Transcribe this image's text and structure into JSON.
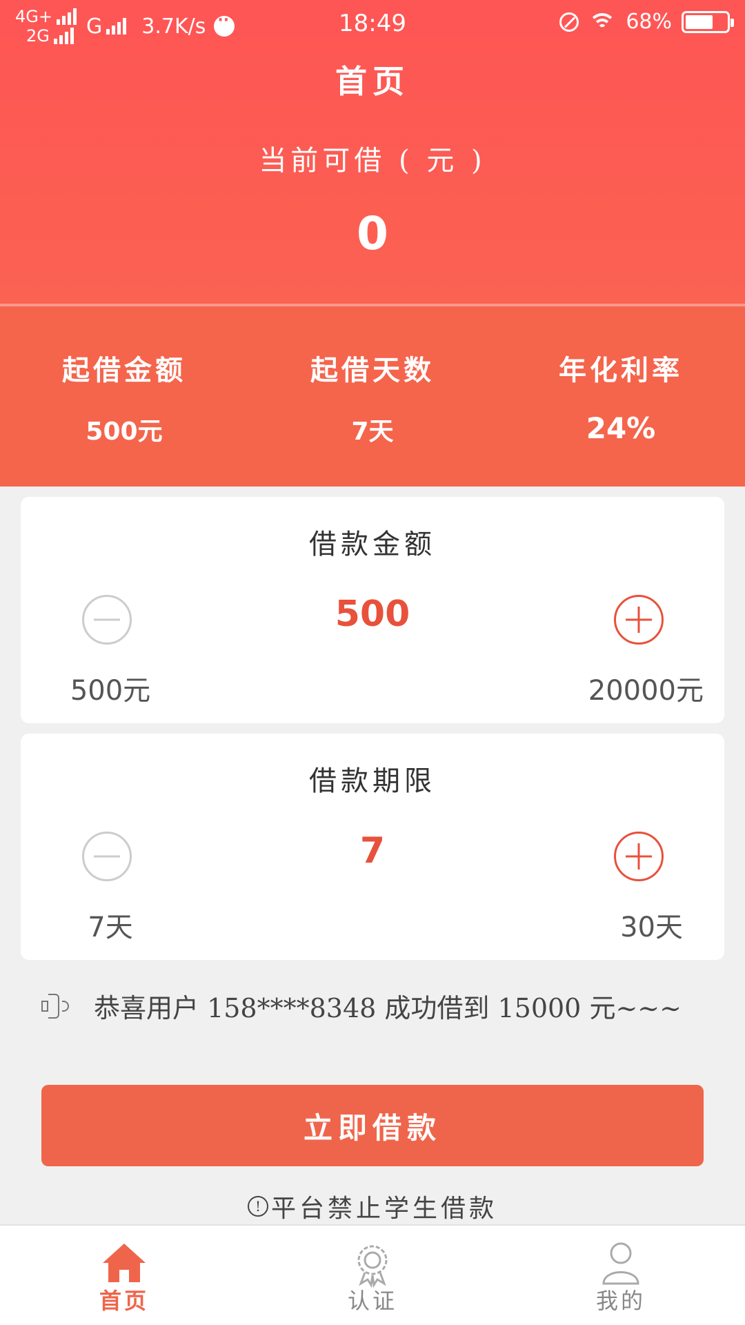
{
  "status_bar": {
    "net1": "4G+",
    "net2": "2G",
    "net3": "G",
    "speed": "3.7K/s",
    "time": "18:49",
    "battery": "68%",
    "battery_level": 0.68
  },
  "header": {
    "title": "首页",
    "available_label": "当前可借 ( 元 )",
    "available_value": "0"
  },
  "stats": [
    {
      "label": "起借金额",
      "value": "500元"
    },
    {
      "label": "起借天数",
      "value": "7天"
    },
    {
      "label": "年化利率",
      "value": "24%"
    }
  ],
  "amount_card": {
    "title": "借款金额",
    "value": "500",
    "min_label": "500元",
    "max_label": "20000元"
  },
  "term_card": {
    "title": "借款期限",
    "value": "7",
    "min_label": "7天",
    "max_label": "30天"
  },
  "notice": {
    "text": "恭喜用户 158****8348 成功借到 15000 元~~~"
  },
  "cta": {
    "label": "立即借款"
  },
  "warning": {
    "text": "平台禁止学生借款"
  },
  "bottom_nav": [
    {
      "label": "首页",
      "icon": "home-icon",
      "active": true
    },
    {
      "label": "认证",
      "icon": "badge-icon",
      "active": false
    },
    {
      "label": "我的",
      "icon": "user-icon",
      "active": false
    }
  ],
  "colors": {
    "primary": "#ef654b",
    "header_top": "#fe5555",
    "accent_value": "#e8513b"
  }
}
